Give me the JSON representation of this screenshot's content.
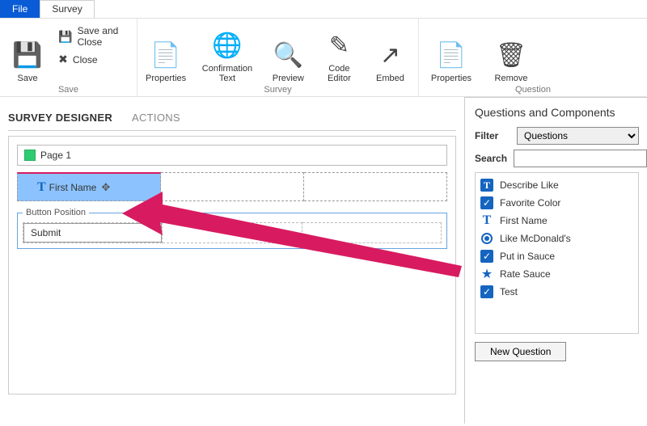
{
  "tabs": {
    "file": "File",
    "survey": "Survey"
  },
  "ribbon": {
    "save_group": {
      "label": "Save",
      "save": "Save",
      "save_close": "Save and Close",
      "close": "Close"
    },
    "survey_group": {
      "label": "Survey",
      "properties": "Properties",
      "confirmation": "Confirmation Text",
      "preview": "Preview",
      "code_editor": "Code Editor",
      "embed": "Embed"
    },
    "question_group": {
      "label": "Question",
      "properties": "Properties",
      "remove": "Remove"
    }
  },
  "designer": {
    "tab_designer": "SURVEY DESIGNER",
    "tab_actions": "ACTIONS",
    "page_label": "Page 1",
    "drag_label": "First Name",
    "button_position_legend": "Button Position",
    "submit_label": "Submit"
  },
  "side": {
    "title": "Questions and Components",
    "filter_label": "Filter",
    "filter_value": "Questions",
    "search_label": "Search",
    "search_value": "",
    "items": [
      {
        "icon": "text",
        "label": "Describe Like"
      },
      {
        "icon": "check",
        "label": "Favorite Color"
      },
      {
        "icon": "tt",
        "label": "First Name"
      },
      {
        "icon": "radio",
        "label": "Like McDonald's"
      },
      {
        "icon": "check",
        "label": "Put in Sauce"
      },
      {
        "icon": "star",
        "label": "Rate Sauce"
      },
      {
        "icon": "check",
        "label": "Test"
      }
    ],
    "new_question": "New Question"
  }
}
